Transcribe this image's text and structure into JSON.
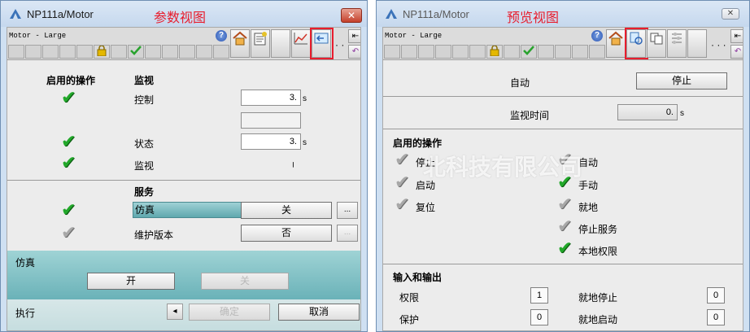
{
  "left": {
    "title": "NP111a/Motor",
    "note": "参数视图",
    "close": "✕",
    "toolbar_title": "Motor - Large",
    "help": "?",
    "left_header": "启用的操作",
    "right_header": "监视",
    "rows": {
      "control": "控制",
      "status": "状态",
      "monitor": "监视",
      "unit": "s"
    },
    "control_value": "3.",
    "status_value": "3.",
    "service_header": "服务",
    "simulation_label": "仿真",
    "simulation_value": "关",
    "maintenance_label": "维护版本",
    "maintenance_value": "否",
    "dots": "...",
    "panel_label": "仿真",
    "on_label": "开",
    "off_label": "关",
    "execute_label": "执行",
    "confirm_label": "确定",
    "cancel_label": "取消"
  },
  "right": {
    "title": "NP111a/Motor",
    "note": "预览视图",
    "close": "✕",
    "toolbar_title": "Motor - Large",
    "help": "?",
    "auto_label": "自动",
    "stop_label": "停止",
    "monitor_time_label": "监视时间",
    "monitor_time_value": "0.",
    "unit": "s",
    "ops_header": "启用的操作",
    "ops_left": [
      "停止",
      "启动",
      "复位"
    ],
    "ops_right": [
      "自动",
      "手动",
      "就地",
      "停止服务",
      "本地权限"
    ],
    "io_header": "输入和输出",
    "io_left": [
      {
        "label": "权限",
        "value": "1"
      },
      {
        "label": "保护",
        "value": "0"
      }
    ],
    "io_right": [
      {
        "label": "就地停止",
        "value": "0"
      },
      {
        "label": "就地启动",
        "value": "0"
      }
    ]
  },
  "watermark": "北科技有限公司",
  "colors": {
    "highlight": "#e81d2d",
    "teal": "#6ab2b8",
    "check_green": "#22a82a"
  }
}
